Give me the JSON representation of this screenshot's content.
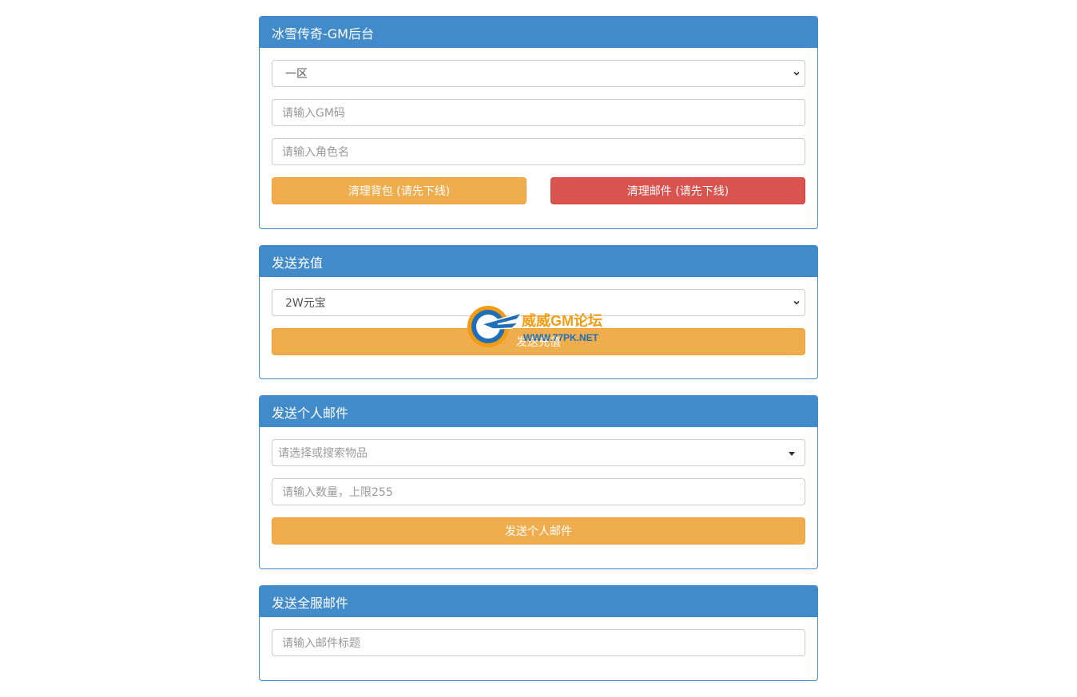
{
  "panels": {
    "gm": {
      "title": "冰雪传奇-GM后台",
      "server_select": "一区",
      "gm_code_placeholder": "请输入GM码",
      "role_placeholder": "请输入角色名",
      "clear_bag_label": "清理背包 (请先下线)",
      "clear_mail_label": "清理邮件 (请先下线)"
    },
    "recharge": {
      "title": "发送充值",
      "amount_select": "2W元宝",
      "send_label": "发送充值"
    },
    "personal_mail": {
      "title": "发送个人邮件",
      "item_placeholder": "请选择或搜索物品",
      "qty_placeholder": "请输入数量，上限255",
      "send_label": "发送个人邮件"
    },
    "global_mail": {
      "title": "发送全服邮件",
      "subject_placeholder": "请输入邮件标题"
    }
  },
  "watermark": {
    "name": "威威GM论坛",
    "url": "WWW.77PK.NET"
  },
  "colors": {
    "primary": "#428bca",
    "warning": "#f0ad4e",
    "danger": "#d9534f"
  }
}
